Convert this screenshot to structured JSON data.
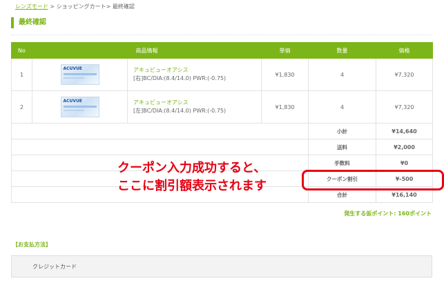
{
  "breadcrumb": {
    "home": "レンズモード",
    "sep1": " > ",
    "cart": "ショッピングカート",
    "sep2": "> ",
    "current": "最終確認"
  },
  "page_title": "最終確認",
  "table": {
    "headers": [
      "No",
      "商品情報",
      "単価",
      "数量",
      "価格"
    ],
    "items": [
      {
        "no": "1",
        "thumb_brand": "ACUVUE",
        "name": "アキュビューオアシス",
        "spec": "[右]BC/DIA:(8.4/14.0) PWR:(-0.75)",
        "unit_price": "¥1,830",
        "qty": "4",
        "price": "¥7,320"
      },
      {
        "no": "2",
        "thumb_brand": "ACUVUE",
        "name": "アキュビューオアシス",
        "spec": "[左]BC/DIA:(8.4/14.0) PWR:(-0.75)",
        "unit_price": "¥1,830",
        "qty": "4",
        "price": "¥7,320"
      }
    ],
    "summary": [
      {
        "label": "小計",
        "value": "¥14,640"
      },
      {
        "label": "送料",
        "value": "¥2,000"
      },
      {
        "label": "手数料",
        "value": "¥0"
      },
      {
        "label": "クーポン割引",
        "value": "¥-500"
      },
      {
        "label": "合計",
        "value": "¥16,140"
      }
    ]
  },
  "callout": {
    "line1": "クーポン入力成功すると、",
    "line2": "ここに割引額表示されます"
  },
  "points_text": "発生する仮ポイント: 160ポイント",
  "payment": {
    "heading": "【お支払方法】",
    "method": "クレジットカード"
  },
  "colors": {
    "accent": "#7cb518",
    "alert": "#e60012"
  }
}
